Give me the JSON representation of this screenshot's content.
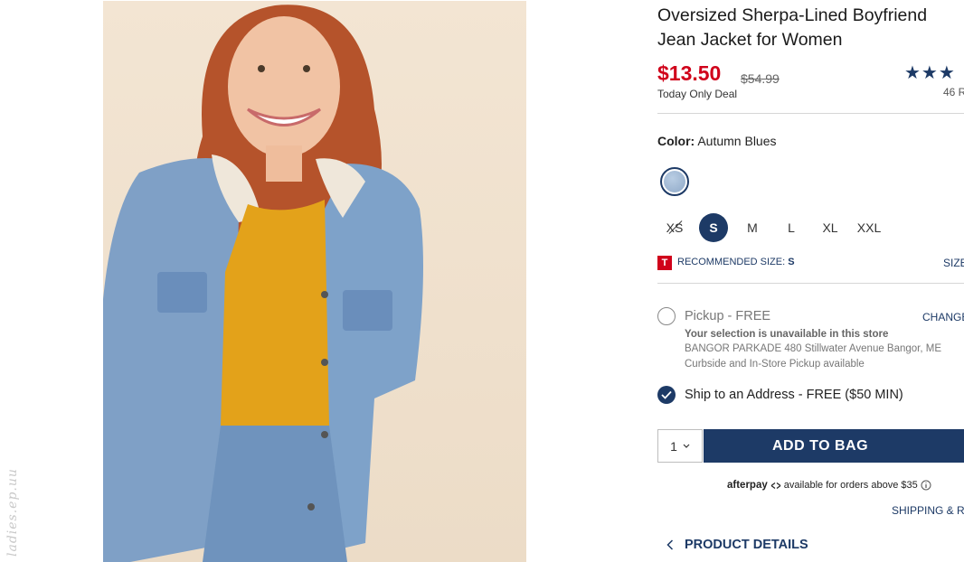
{
  "product": {
    "title": "Oversized Sherpa-Lined Boyfriend Jean Jacket for Women",
    "price": "$13.50",
    "original_price": "$54.99",
    "deal_label": "Today Only Deal",
    "rating_stars": "★★★",
    "reviews_text": "46 R",
    "image_icon": "product-photo"
  },
  "color": {
    "label": "Color:",
    "value": "Autumn Blues"
  },
  "sizes": [
    {
      "label": "XS",
      "available": false,
      "selected": false
    },
    {
      "label": "S",
      "available": true,
      "selected": true
    },
    {
      "label": "M",
      "available": true,
      "selected": false
    },
    {
      "label": "L",
      "available": true,
      "selected": false
    },
    {
      "label": "XL",
      "available": true,
      "selected": false
    },
    {
      "label": "XXL",
      "available": true,
      "selected": false
    }
  ],
  "recommend": {
    "badge": "T",
    "label": "RECOMMENDED SIZE:",
    "size": "S",
    "size_chart": "SIZE"
  },
  "fulfillment": {
    "pickup_label": "Pickup - FREE",
    "change_label": "CHANGE",
    "unavailable": "Your selection is unavailable in this store",
    "store": "BANGOR PARKADE 480 Stillwater Avenue  Bangor, ME",
    "curbside": "Curbside and In-Store Pickup available",
    "ship_label": "Ship to an Address - FREE ($50 MIN)"
  },
  "cart": {
    "quantity": "1",
    "add_label": "ADD TO BAG"
  },
  "afterpay": {
    "brand": "afterpay",
    "text": "available for orders above $35"
  },
  "links": {
    "shipping": "SHIPPING & RE",
    "product_details": "PRODUCT DETAILS"
  },
  "watermark": "ladies.ep.uu",
  "colors": {
    "price_red": "#d0021b",
    "navy": "#1d3a66"
  }
}
